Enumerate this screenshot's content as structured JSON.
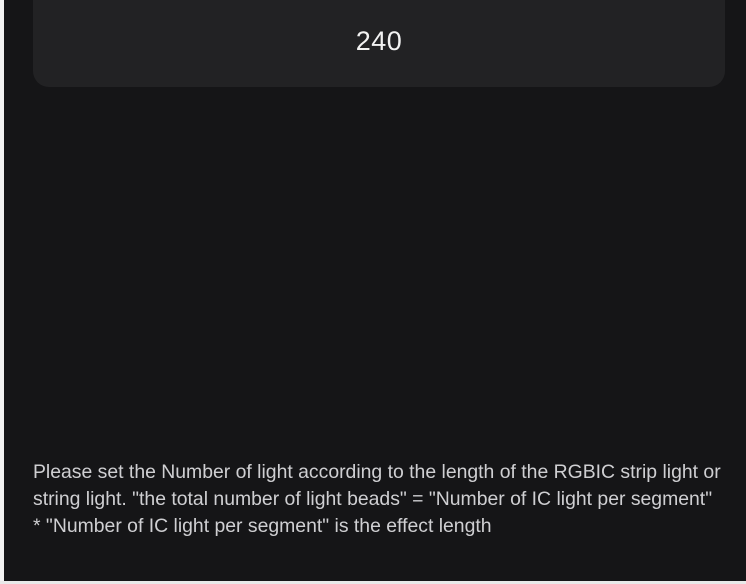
{
  "light_count": {
    "value": "240"
  },
  "helper": {
    "text": "Please set the Number of light according to the length of the RGBIC strip light or string light. \"the total number of light beads\" = \"Number of IC light per segment\" * \"Number of IC light per segment\" is the effect length"
  },
  "colors": {
    "background": "#151517",
    "card": "#222224",
    "text": "#f2f2f2",
    "secondary_text": "#cfcfd2"
  }
}
